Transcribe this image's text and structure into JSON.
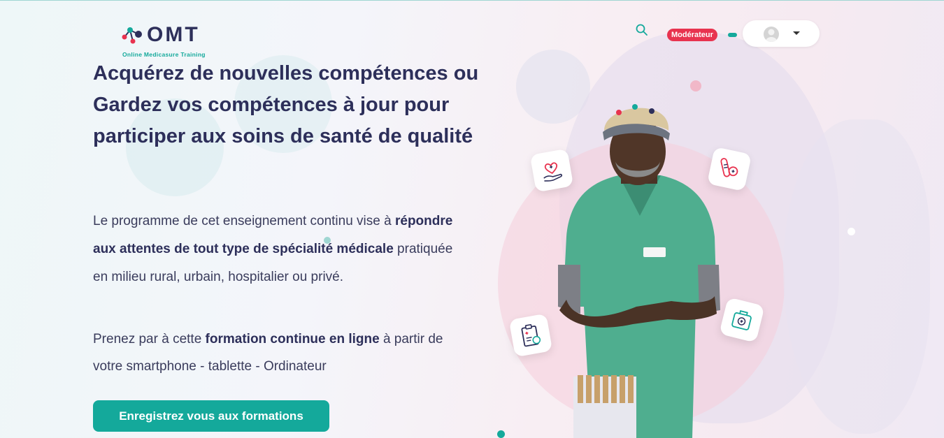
{
  "brand": {
    "name": "OMT",
    "tagline": "Online Medicasure Training"
  },
  "header": {
    "role_badge": "Modérateur"
  },
  "hero": {
    "title": "Acquérez de nouvelles compétences ou Gardez vos compétences à jour pour participer aux soins de santé de qualité",
    "p1_a": "Le programme de cet enseignement continu vise à ",
    "p1_bold": "répondre aux attentes de tout type de spécialité médicale",
    "p1_b": " pratiquée en milieu rural, urbain, hospitalier ou privé.",
    "p2_a": "Prenez par à cette ",
    "p2_bold": "formation continue en ligne",
    "p2_b": " à partir de votre smartphone - tablette - Ordinateur",
    "cta_label": "Enregistrez vous aux formations"
  },
  "illustration": {
    "icons": [
      "heart-hand-icon",
      "test-tube-icon",
      "clipboard-icon",
      "first-aid-kit-icon"
    ]
  },
  "colors": {
    "accent": "#14a99b",
    "heading": "#2d2f5a",
    "badge": "#e8334f"
  }
}
